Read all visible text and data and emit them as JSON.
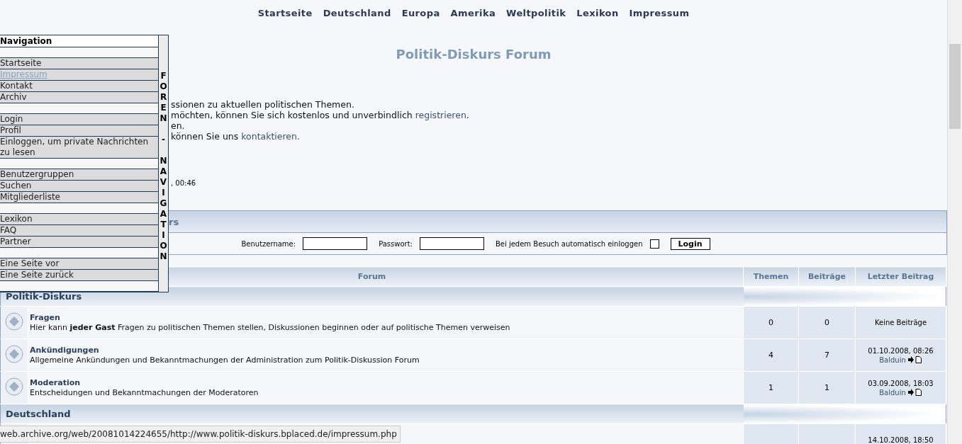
{
  "top_nav": [
    "Startseite",
    "Deutschland",
    "Europa",
    "Amerika",
    "Weltpolitik",
    "Lexikon",
    "Impressum"
  ],
  "title": "Politik-Diskurs Forum",
  "intro": [
    {
      "text": "ssionen zu aktuellen politischen Themen."
    },
    {
      "text": "möchten, können Sie sich kostenlos und unverbindlich ",
      "link": "registrieren",
      "after": "."
    },
    {
      "text": "en."
    },
    {
      "text": "können Sie uns ",
      "link": "kontaktieren."
    }
  ],
  "time_fragment": ", 00:46",
  "login": {
    "header": "rs",
    "username_label": "Benutzername:",
    "password_label": "Passwort:",
    "auto_label": "Bei jedem Besuch automatisch einloggen",
    "auto_checked": false,
    "button": "Login"
  },
  "table": {
    "columns": [
      "Forum",
      "Themen",
      "Beiträge",
      "Letzter Beitrag"
    ],
    "sections": [
      {
        "category": "Politik-Diskurs",
        "forums": [
          {
            "name": "Fragen",
            "description": "Hier kann **jeder Gast** Fragen zu politischen Themen stellen, Diskussionen beginnen oder auf politische Themen verweisen",
            "topics": "0",
            "posts": "0",
            "last_post": {
              "text": "Keine Beiträge"
            }
          },
          {
            "name": "Ankündigungen",
            "description": "Allgemeine Ankündungen und Bekanntmachungen der Administration zum Politik-Diskussion Forum",
            "topics": "4",
            "posts": "7",
            "last_post": {
              "date": "01.10.2008, 08:26",
              "author": "Balduin"
            }
          },
          {
            "name": "Moderation",
            "description": "Entscheidungen und Bekanntmachungen der Moderatoren",
            "topics": "1",
            "posts": "1",
            "last_post": {
              "date": "03.09.2008, 18:03",
              "author": "Balduin"
            }
          }
        ]
      },
      {
        "category": "Deutschland",
        "forums": [
          {
            "last_post": {
              "date": "14.10.2008, 18:50"
            }
          }
        ]
      }
    ]
  },
  "side_nav": {
    "title": "Navigation",
    "side_label": "FOREN - NAVIGATION",
    "groups": [
      [
        {
          "label": "Startseite",
          "hovered": false
        },
        {
          "label": "Impressum",
          "hovered": true
        },
        {
          "label": "Kontakt",
          "hovered": false
        },
        {
          "label": "Archiv",
          "hovered": false
        }
      ],
      [
        {
          "label": "Login",
          "hovered": false
        },
        {
          "label": "Profil",
          "hovered": false
        },
        {
          "label": "Einloggen, um private Nachrichten zu lesen",
          "hovered": false
        }
      ],
      [
        {
          "label": "Benutzergruppen",
          "hovered": false
        },
        {
          "label": "Suchen",
          "hovered": false
        },
        {
          "label": "Mitgliederliste",
          "hovered": false
        }
      ],
      [
        {
          "label": "Lexikon",
          "hovered": false
        },
        {
          "label": "FAQ",
          "hovered": false
        },
        {
          "label": "Partner",
          "hovered": false
        }
      ],
      [
        {
          "label": "Eine Seite vor",
          "hovered": false
        },
        {
          "label": "Eine Seite zurück",
          "hovered": false
        }
      ]
    ]
  },
  "status_bar": "web.archive.org/web/20081014224655/http://www.politik-diskurs.bplaced.de/impressum.php"
}
